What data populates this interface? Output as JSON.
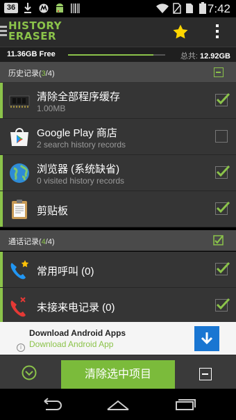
{
  "status_bar": {
    "notification_count": "36",
    "time": "7:42",
    "icons": [
      "download-icon",
      "motorola-icon",
      "android-icon",
      "barcode-icon",
      "wifi-icon",
      "no-sim-icon",
      "battery-icon"
    ]
  },
  "app_bar": {
    "logo_line1": "HISTORY",
    "logo_line2": "ERASER",
    "icons": [
      "star-icon",
      "overflow-menu-icon"
    ]
  },
  "storage": {
    "free": "11.36GB Free",
    "total_label": "总共:",
    "total_value": "12.92GB",
    "used_fraction": 0.88
  },
  "sections": [
    {
      "title": "历史记录",
      "count_open": "(",
      "count_selected": "3",
      "count_sep": "/",
      "count_total": "4",
      "count_close": ")",
      "control": "minus"
    },
    {
      "title": "通话记录",
      "count_open": "(",
      "count_selected": "4",
      "count_sep": "/",
      "count_total": "4",
      "count_close": ")",
      "control": "check"
    }
  ],
  "history_items": [
    {
      "title": "清除全部程序缓存",
      "subtitle": "1.00MB",
      "checked": true,
      "icon": "memory-chip-icon"
    },
    {
      "title": "Google Play 商店",
      "subtitle": "2 search history records",
      "checked": false,
      "icon": "google-play-icon"
    },
    {
      "title": "浏览器 (系统缺省)",
      "subtitle": "0 visited history records",
      "checked": true,
      "icon": "globe-icon"
    },
    {
      "title": "剪贴板",
      "subtitle": "",
      "checked": true,
      "icon": "clipboard-icon"
    }
  ],
  "call_items": [
    {
      "title": "常用呼叫 (0)",
      "checked": true,
      "icon": "favorite-call-icon"
    },
    {
      "title": "未接来电记录 (0)",
      "checked": true,
      "icon": "missed-call-icon"
    }
  ],
  "ad": {
    "title": "Download Android Apps",
    "subtitle": "Download Android App",
    "info": "i"
  },
  "bottom_bar": {
    "clear_label": "清除选中项目"
  },
  "colors": {
    "accent": "#8bc34a",
    "row_bg": "#353535",
    "section_bg": "#4a4a4a",
    "ad_button": "#1976d2"
  }
}
